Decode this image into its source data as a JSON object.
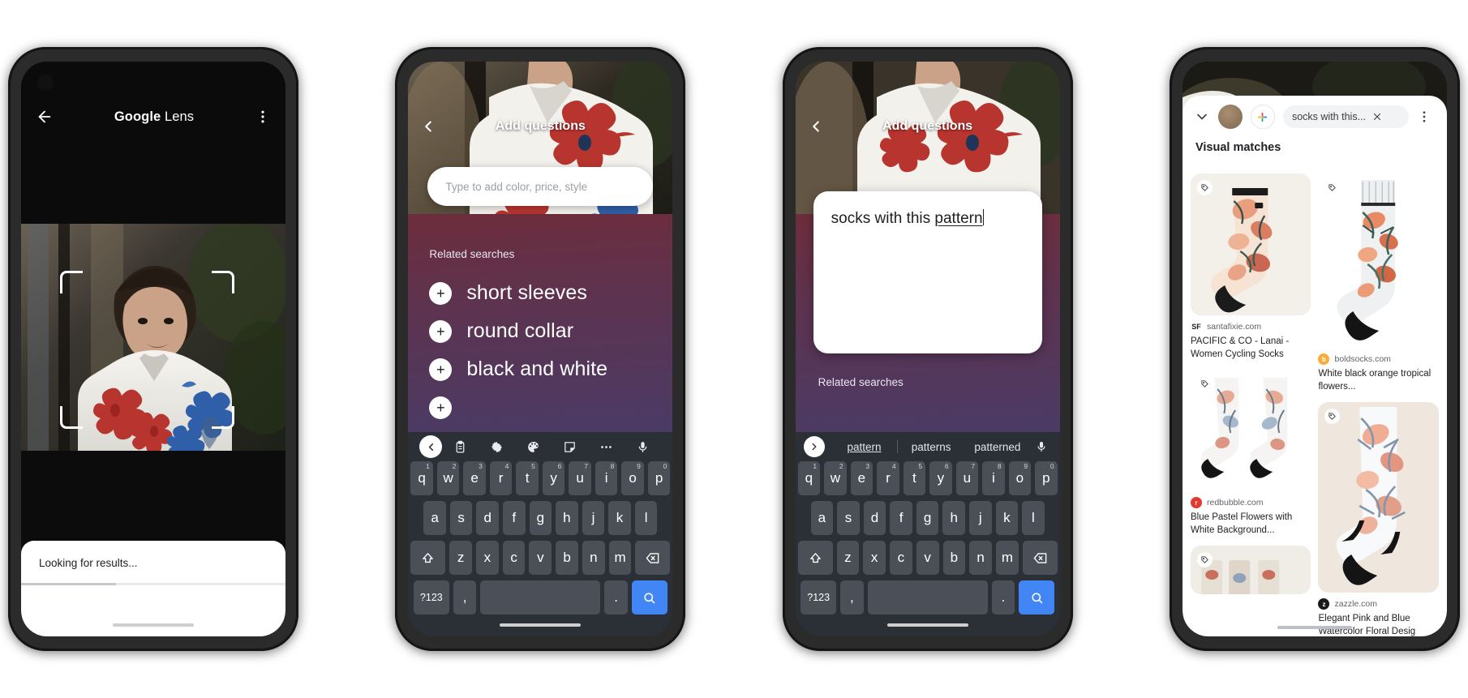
{
  "phone1": {
    "header": {
      "back_icon": "arrow-left-icon",
      "title_bold": "Google",
      "title_light": "Lens",
      "menu_icon": "more-vert-icon"
    },
    "crop_overlay": "crop-frame",
    "sheet": {
      "status": "Looking for results...",
      "progress_percent": 36
    }
  },
  "phone2": {
    "header": {
      "back_icon": "chevron-left-icon",
      "title": "Add questions"
    },
    "input": {
      "placeholder": "Type to add color, price, style",
      "value": ""
    },
    "related": {
      "label": "Related searches",
      "items": [
        {
          "add_icon": "plus-icon",
          "label": "short sleeves"
        },
        {
          "add_icon": "plus-icon",
          "label": "round collar"
        },
        {
          "add_icon": "plus-icon",
          "label": "black and white"
        }
      ]
    },
    "keyboard": {
      "toolbar_icons": [
        "chevron-left-icon",
        "clipboard-icon",
        "gear-icon",
        "palette-icon",
        "sticker-icon",
        "more-horiz-icon",
        "mic-icon"
      ],
      "row1": [
        {
          "k": "q",
          "n": "1"
        },
        {
          "k": "w",
          "n": "2"
        },
        {
          "k": "e",
          "n": "3"
        },
        {
          "k": "r",
          "n": "4"
        },
        {
          "k": "t",
          "n": "5"
        },
        {
          "k": "y",
          "n": "6"
        },
        {
          "k": "u",
          "n": "7"
        },
        {
          "k": "i",
          "n": "8"
        },
        {
          "k": "o",
          "n": "9"
        },
        {
          "k": "p",
          "n": "0"
        }
      ],
      "row2": [
        "a",
        "s",
        "d",
        "f",
        "g",
        "h",
        "j",
        "k",
        "l"
      ],
      "row3": [
        "z",
        "x",
        "c",
        "v",
        "b",
        "n",
        "m"
      ],
      "shift_icon": "shift-icon",
      "backspace_icon": "backspace-icon",
      "numeric_label": "?123",
      "comma_label": ",",
      "period_label": ".",
      "search_icon": "search-icon"
    }
  },
  "phone3": {
    "header": {
      "back_icon": "chevron-left-icon",
      "title": "Add questions"
    },
    "composer": {
      "text_before": "socks with this ",
      "text_underlined": "pattern",
      "caret": true
    },
    "related_label": "Related searches",
    "suggestions": {
      "expand_icon": "chevron-right-icon",
      "items": [
        "pattern",
        "patterns",
        "patterned"
      ],
      "active_index": 0,
      "mic_icon": "mic-icon"
    }
  },
  "phone4": {
    "header": {
      "collapse_icon": "chevron-down-icon",
      "avatar": "avatar",
      "add_icon": "google-plus-icon",
      "chip_label": "socks with this...",
      "chip_close_icon": "close-icon",
      "menu_icon": "more-vert-icon"
    },
    "section_title": "Visual matches",
    "results": [
      {
        "tag_icon": "price-tag-icon",
        "favicon_text": "SF",
        "favicon_color": "#202124",
        "favicon_plain": true,
        "domain": "santafixie.com",
        "title": "PACIFIC & CO - Lanai - Women Cycling Socks",
        "image": "sock-floral-peach"
      },
      {
        "tag_icon": "price-tag-icon",
        "favicon_text": "b",
        "favicon_color": "#f6ad3c",
        "favicon_plain": false,
        "domain": "boldsocks.com",
        "title": "White black orange tropical flowers...",
        "image": "sock-tropical-tall"
      },
      {
        "tag_icon": "price-tag-icon",
        "favicon_text": "r",
        "favicon_color": "#e4392f",
        "favicon_plain": false,
        "domain": "redbubble.com",
        "title": "Blue Pastel Flowers with White Background...",
        "image": "socks-pair-blue"
      },
      {
        "tag_icon": "price-tag-icon",
        "favicon_text": "z",
        "favicon_color": "#1a1a1a",
        "favicon_plain": false,
        "domain": "zazzle.com",
        "title": "Elegant Pink and Blue Watercolor Floral Desig",
        "image": "sock-pink-blue"
      },
      {
        "tag_icon": "price-tag-icon",
        "favicon_text": "",
        "favicon_color": "#cccccc",
        "favicon_plain": false,
        "domain": "",
        "title": "",
        "image": "socks-grid-partial"
      }
    ]
  },
  "colors": {
    "accent_blue": "#4285f4",
    "keyboard_bg": "#2b2f36",
    "key_bg": "#4a4f58",
    "gradient_top": "#6d2d3c",
    "gradient_bottom": "#3b3f6d"
  }
}
